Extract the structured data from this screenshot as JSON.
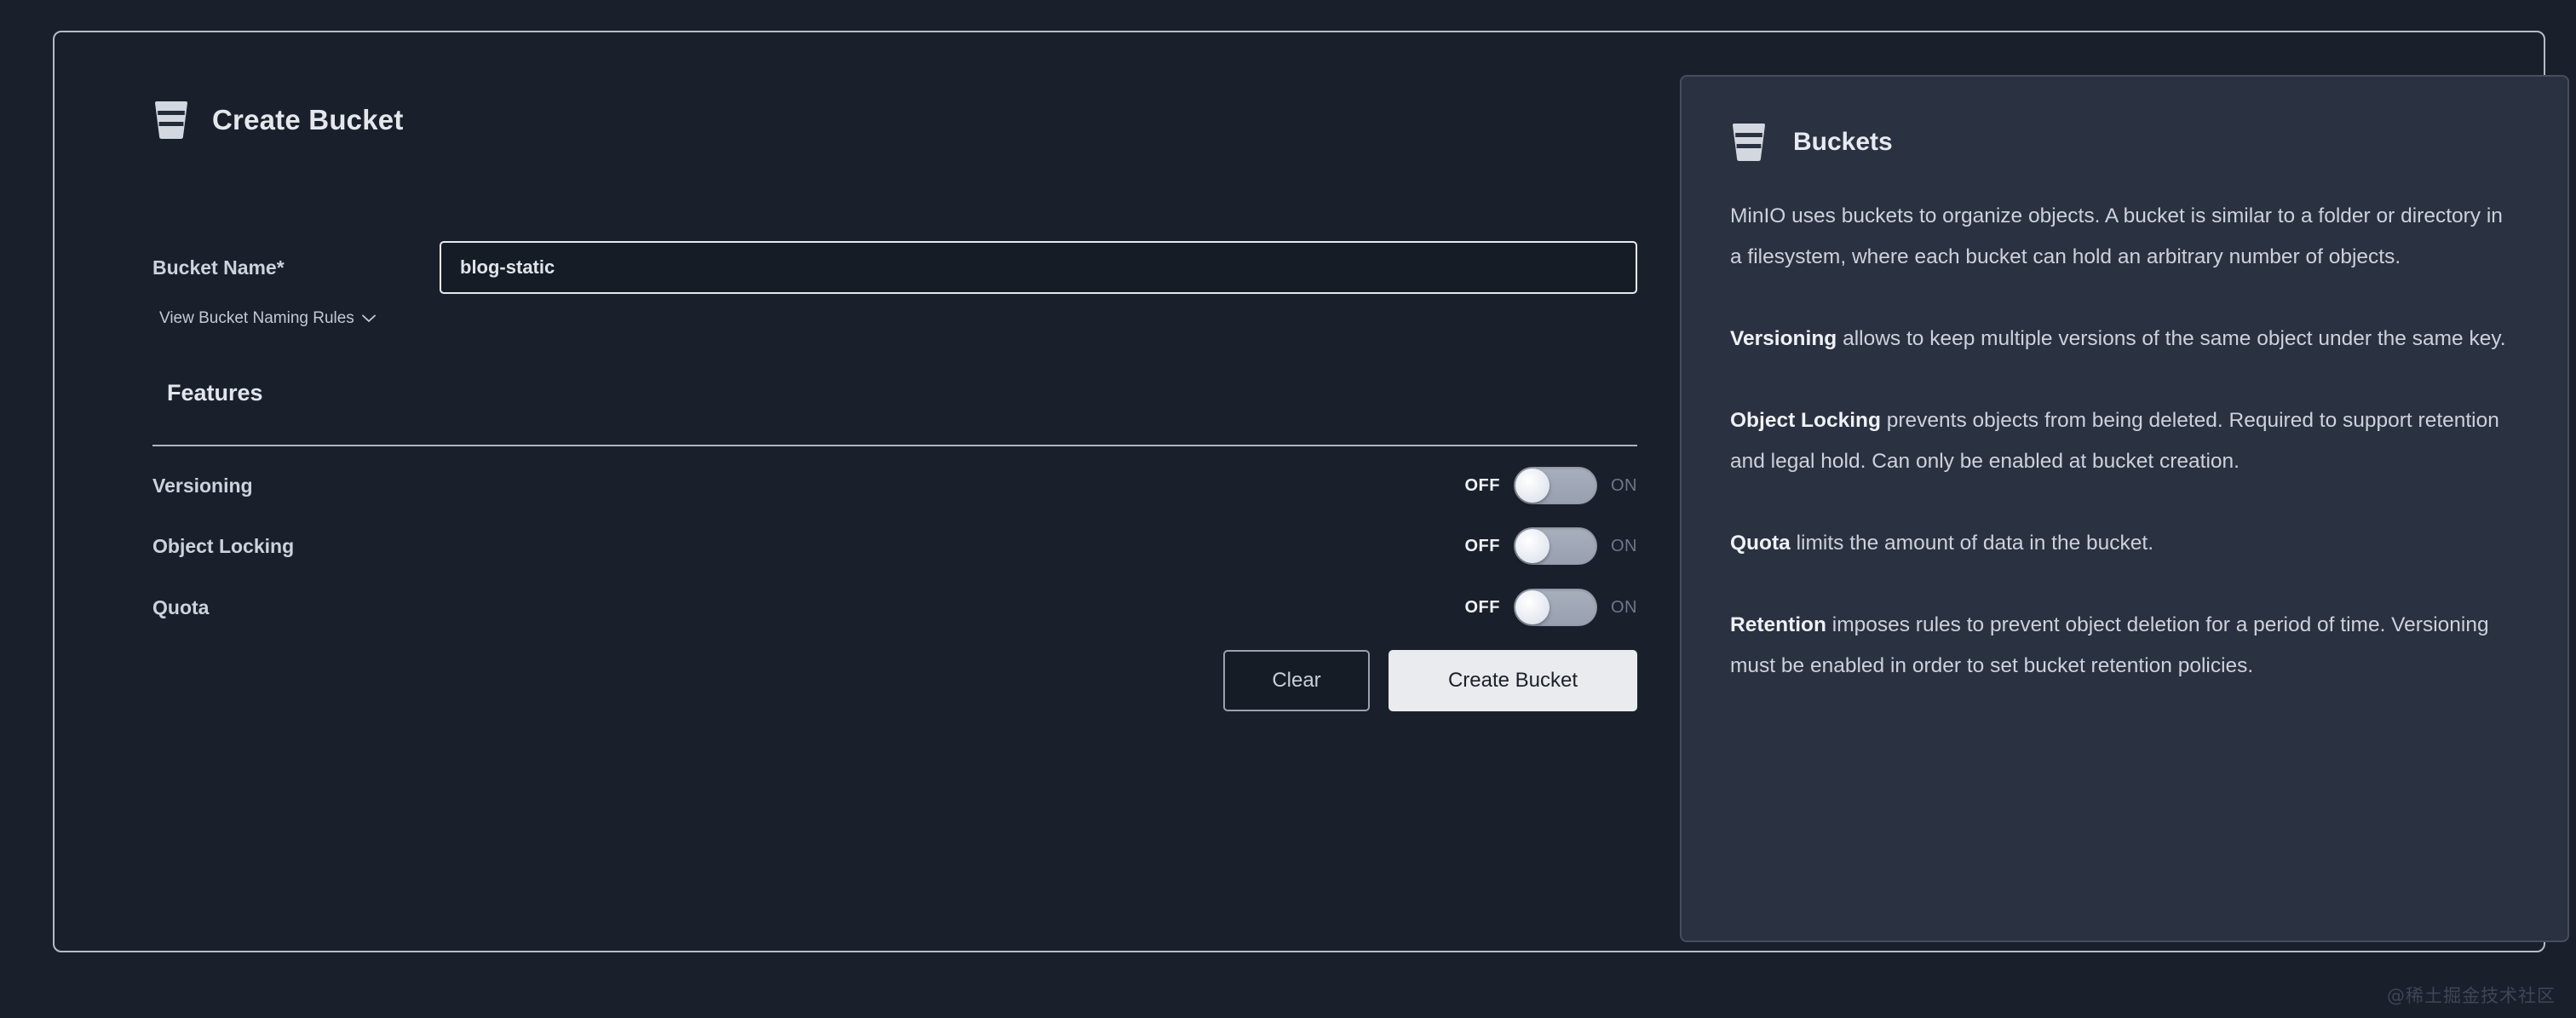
{
  "form": {
    "title": "Create Bucket",
    "icon": "bucket-icon",
    "bucket_name_label": "Bucket Name*",
    "bucket_name_value": "blog-static",
    "bucket_name_placeholder": "",
    "naming_rules_link": "View Bucket Naming Rules",
    "features_heading": "Features",
    "features": [
      {
        "label": "Versioning",
        "off_label": "OFF",
        "on_label": "ON",
        "state": "off"
      },
      {
        "label": "Object Locking",
        "off_label": "OFF",
        "on_label": "ON",
        "state": "off"
      },
      {
        "label": "Quota",
        "off_label": "OFF",
        "on_label": "ON",
        "state": "off"
      }
    ],
    "clear_button": "Clear",
    "create_button": "Create Bucket"
  },
  "info": {
    "title": "Buckets",
    "icon": "bucket-icon",
    "paragraphs": [
      {
        "lead": "",
        "text": "MinIO uses buckets to organize objects. A bucket is similar to a folder or directory in a filesystem, where each bucket can hold an arbitrary number of objects."
      },
      {
        "lead": "Versioning",
        "text": " allows to keep multiple versions of the same object under the same key."
      },
      {
        "lead": "Object Locking",
        "text": " prevents objects from being deleted. Required to support retention and legal hold. Can only be enabled at bucket creation."
      },
      {
        "lead": "Quota",
        "text": " limits the amount of data in the bucket."
      },
      {
        "lead": "Retention",
        "text": " imposes rules to prevent object deletion for a period of time. Versioning must be enabled in order to set bucket retention policies."
      }
    ]
  },
  "watermark": "@稀土掘金技术社区",
  "colors": {
    "page_background": "#1a202b",
    "card_border": "#b5bcc8",
    "info_panel_background": "#2a3140",
    "primary_text": "#e4e7ec",
    "muted_text": "#ccd2dc",
    "toggle_track": "#9aa2b0",
    "create_button_background": "#e9ebee"
  }
}
